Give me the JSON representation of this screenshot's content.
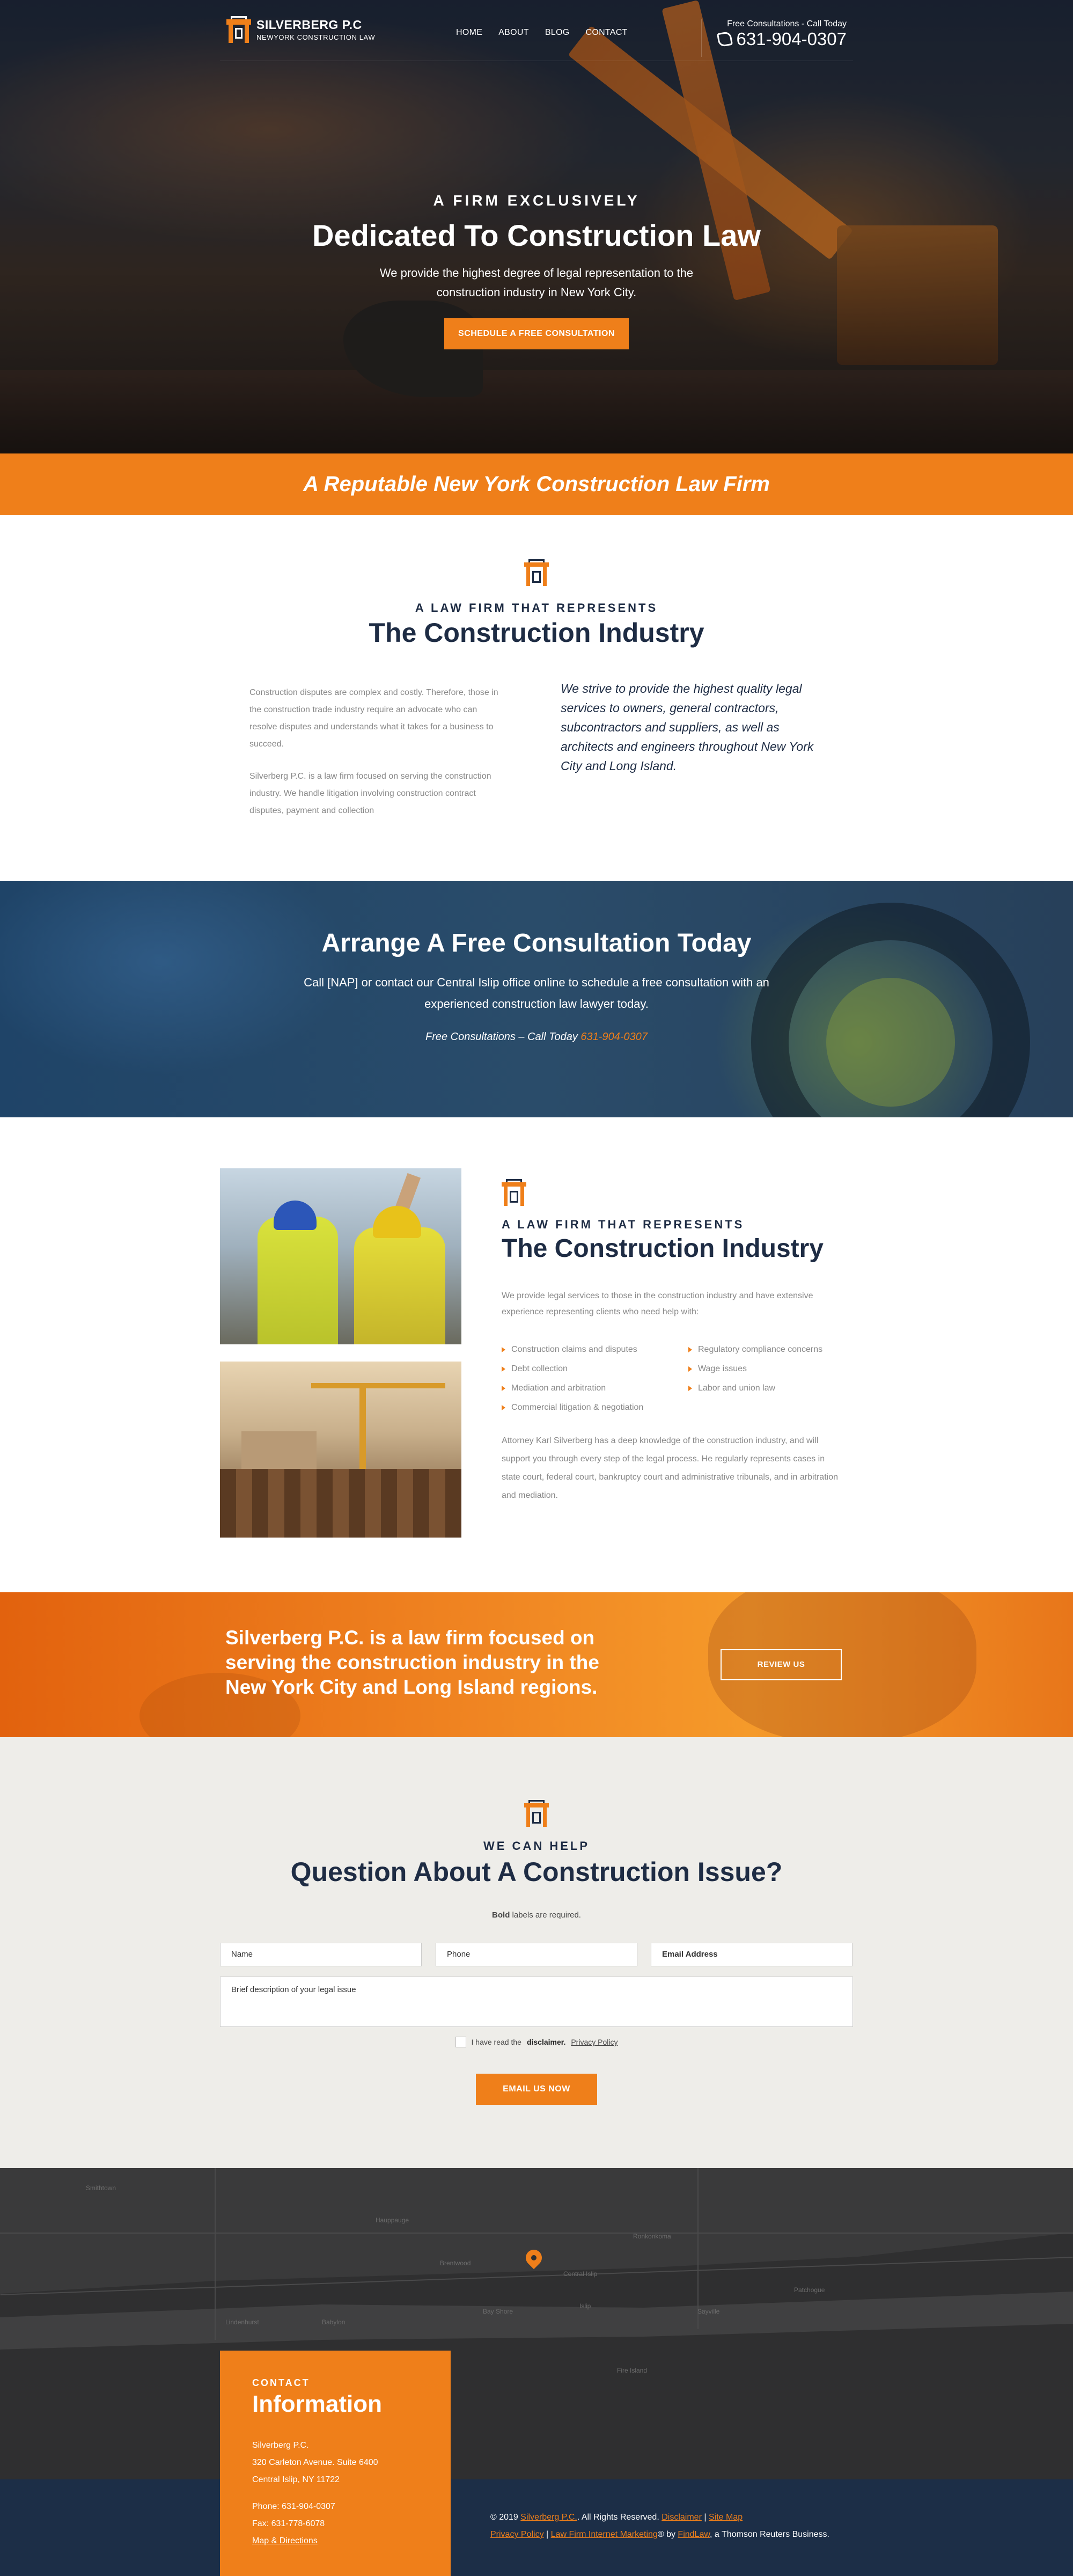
{
  "header": {
    "logo_name": "SILVERBERG P.C",
    "logo_tagline": "NEWYORK CONSTRUCTION LAW",
    "nav": [
      "HOME",
      "ABOUT",
      "BLOG",
      "CONTACT"
    ],
    "call_label": "Free Consultations - Call Today",
    "phone": "631-904-0307"
  },
  "hero": {
    "eyebrow": "A FIRM EXCLUSIVELY",
    "title": "Dedicated To Construction Law",
    "subtitle": "We provide the highest degree of legal representation to the construction industry in New York City.",
    "cta": "SCHEDULE A FREE CONSULTATION"
  },
  "stripe": {
    "text": "A Reputable New York Construction Law Firm"
  },
  "represents": {
    "kicker": "A LAW FIRM THAT REPRESENTS",
    "title": "The Construction Industry",
    "left_p1": "Construction disputes are complex and costly. Therefore, those in the construction trade industry require an advocate who can resolve disputes and understands what it takes for a business to succeed.",
    "left_p2": "Silverberg P.C. is a law firm focused on serving the construction industry. We handle litigation involving construction contract disputes, payment and collection",
    "right_quote": "We strive to provide the highest quality legal services to owners, general contractors, subcontractors and suppliers, as well as architects and engineers throughout New York City and Long Island."
  },
  "consult": {
    "title": "Arrange A Free Consultation Today",
    "body": "Call [NAP] or contact our Central Islip office online to schedule a free consultation with an experienced construction law lawyer today.",
    "call_prefix": "Free Consultations – Call Today",
    "phone": "631-904-0307"
  },
  "services": {
    "kicker": "A LAW FIRM THAT REPRESENTS",
    "title": "The Construction Industry",
    "intro": "We provide legal services to those in the construction industry and have extensive experience representing clients who need help with:",
    "items": [
      "Construction claims and disputes",
      "Regulatory compliance concerns",
      "Debt collection",
      "Wage issues",
      "Mediation and arbitration",
      "Labor and union law",
      "Commercial litigation & negotiation"
    ],
    "outro": "Attorney Karl Silverberg has a deep knowledge of the construction industry, and will support you through every step of the legal process. He regularly represents cases in state court, federal court, bankruptcy court and administrative tribunals, and in arbitration and mediation."
  },
  "banner": {
    "text": "Silverberg P.C. is a law firm focused on serving the construction industry in the New York City and Long Island regions.",
    "button": "REVIEW US"
  },
  "form": {
    "kicker": "WE CAN HELP",
    "title": "Question About A Construction Issue?",
    "required_bold": "Bold",
    "required_rest": " labels are required.",
    "name_placeholder": "Name",
    "phone_placeholder": "Phone",
    "email_placeholder": "Email Address",
    "message_placeholder": "Brief description of your legal issue",
    "consent_prefix": "I have read the",
    "consent_link": "disclaimer",
    "privacy_link": "Privacy Policy",
    "submit": "EMAIL US NOW"
  },
  "contact_card": {
    "kicker": "CONTACT",
    "title": "Information",
    "firm": "Silverberg P.C.",
    "street": "320 Carleton Avenue. Suite 6400",
    "city": "Central Islip, NY 11722",
    "phone": "Phone: 631-904-0307",
    "fax": "Fax: 631-778-6078",
    "directions": "Map & Directions"
  },
  "footer": {
    "copyright_prefix": "© 2019",
    "firm_link": "Silverberg P.C.",
    "rights": "All Rights Reserved.",
    "disclaimer": "Disclaimer",
    "sitemap": "Site Map",
    "privacy": "Privacy Policy",
    "marketing": "Law Firm Internet Marketing",
    "by": "® by",
    "findlaw": "FindLaw",
    "suffix": ", a Thomson Reuters Business."
  },
  "map_labels": [
    "Smithtown",
    "Central Islip",
    "Bay Shore",
    "Islip",
    "Hauppauge",
    "Ronkonkoma",
    "Patchogue",
    "Brentwood",
    "Sayville",
    "Lindenhurst",
    "Babylon",
    "Fire Island"
  ],
  "colors": {
    "accent": "#ef7f1a",
    "navy": "#1e2c44",
    "footer": "#1c2e47",
    "form_bg": "#eeede9"
  }
}
